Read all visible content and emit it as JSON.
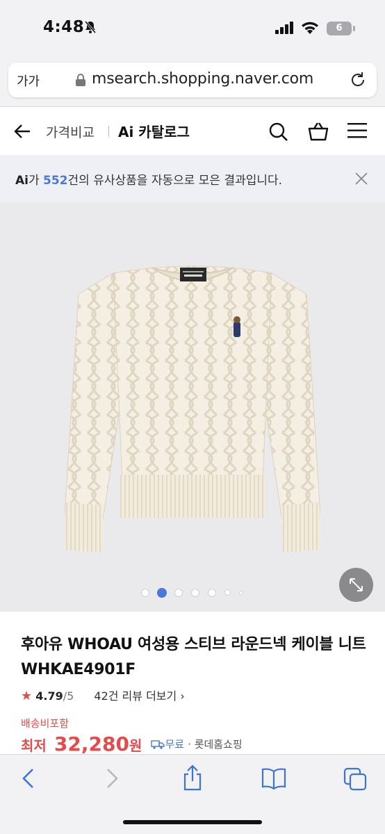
{
  "status_bar": {
    "time": "4:48",
    "battery": "6"
  },
  "browser": {
    "text_size_label": "가가",
    "url": "msearch.shopping.naver.com"
  },
  "header": {
    "nav_compare": "가격비교",
    "ai_catalog": "Ai 카탈로그"
  },
  "notice": {
    "ai_label": "Ai",
    "prefix": "가 ",
    "count": "552",
    "suffix": "건의 유사상품을 자동으로 모은 결과입니다."
  },
  "gallery": {
    "total_dots": 7,
    "active_index": 1
  },
  "product": {
    "title": "후아유 WHOAU 여성용 스티브 라운드넥 케이블 니트 WHKAE4901F",
    "rating_score": "4.79",
    "rating_out_of": "/5",
    "reviews": "42건 리뷰 더보기",
    "shipping": "배송비포함",
    "price_label": "최저",
    "price": "32,280",
    "price_unit": "원",
    "delivery_free": "무료",
    "mall": "· 롯데홈쇼핑"
  },
  "icons": [
    "bell-slash-icon",
    "signal-icon",
    "wifi-icon",
    "lock-icon",
    "reload-icon",
    "back-arrow-icon",
    "search-icon",
    "cart-icon",
    "menu-icon",
    "close-icon",
    "expand-icon",
    "truck-icon",
    "browser-back-icon",
    "browser-forward-icon",
    "share-icon",
    "bookmarks-icon",
    "tabs-icon"
  ],
  "colors": {
    "accent": "#4a78d6",
    "price": "#e44b4b",
    "chrome": "#f2f2f4",
    "notice_bg": "#eef0f5"
  }
}
